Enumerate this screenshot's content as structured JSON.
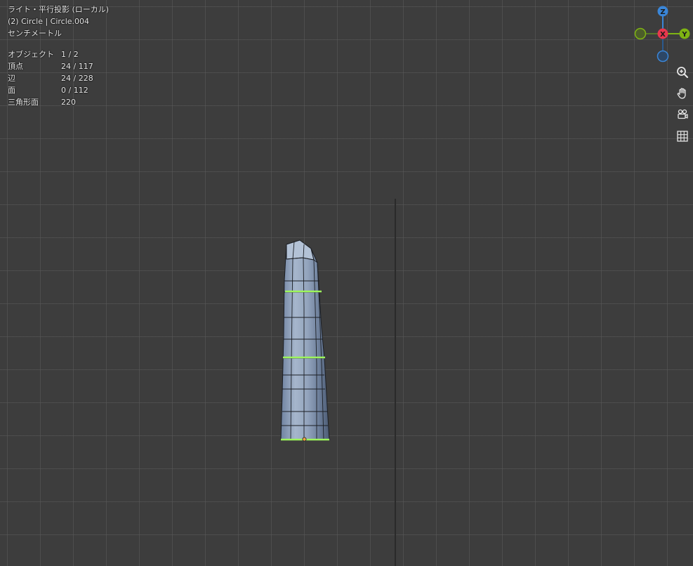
{
  "view_info": {
    "line1": "ライト・平行投影 (ローカル)",
    "line2": "(2) Circle | Circle.004",
    "line3": "センチメートル"
  },
  "stats": [
    {
      "label": "オブジェクト",
      "value": "1 / 2"
    },
    {
      "label": "頂点",
      "value": "24 / 117"
    },
    {
      "label": "辺",
      "value": "24 / 228"
    },
    {
      "label": "面",
      "value": "0 / 112"
    },
    {
      "label": "三角形面",
      "value": "220"
    }
  ],
  "gizmo": {
    "z_label": "Z",
    "x_label": "X",
    "y_label": "Y",
    "colors": {
      "x": "#e8374e",
      "y": "#7fb413",
      "z": "#3a86d8"
    }
  },
  "nav_buttons": [
    {
      "icon": "zoom-icon"
    },
    {
      "icon": "hand-pan-icon"
    },
    {
      "icon": "camera-view-icon"
    },
    {
      "icon": "grid-ortho-icon"
    }
  ],
  "colors": {
    "background": "#3d3d3d",
    "mesh_face": "#8a9bb5",
    "selected_edge": "#9df55c"
  }
}
